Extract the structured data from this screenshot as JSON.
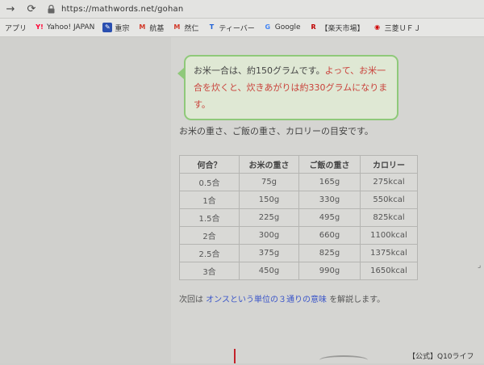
{
  "browser": {
    "url": "https://mathwords.net/gohan"
  },
  "bookmarks": [
    {
      "label": "アプリ",
      "icon": "apps-icon",
      "glyph": "",
      "color": ""
    },
    {
      "label": "Yahoo! JAPAN",
      "icon": "yahoo-icon",
      "glyph": "Y!",
      "color": "#ff0033"
    },
    {
      "label": "重宗",
      "icon": "bookmark-icon",
      "glyph": "✎",
      "color": "#2a4fb0"
    },
    {
      "label": "航基",
      "icon": "m-icon",
      "glyph": "M",
      "color": "#d23a2a"
    },
    {
      "label": "然仁",
      "icon": "m-icon",
      "glyph": "M",
      "color": "#d23a2a"
    },
    {
      "label": "ティーバー",
      "icon": "tver-icon",
      "glyph": "T",
      "color": "#1d5fd6"
    },
    {
      "label": "Google",
      "icon": "google-icon",
      "glyph": "G",
      "color": "#4285f4"
    },
    {
      "label": "【楽天市場】",
      "icon": "rakuten-icon",
      "glyph": "R",
      "color": "#bf0000"
    },
    {
      "label": "三菱ＵＦＪ",
      "icon": "mufg-icon",
      "glyph": "◉",
      "color": "#d00000"
    }
  ],
  "bubble": {
    "text1": "お米一合は、約150グラムです。",
    "text2": "よって、お米一合を炊くと、",
    "text3": "炊きあがりは約330グラムになります。"
  },
  "intro": "お米の重さ、ご飯の重さ、カロリーの目安です。",
  "table": {
    "headers": [
      "何合？",
      "お米の重さ",
      "ご飯の重さ",
      "カロリー"
    ],
    "rows": [
      [
        "0.5合",
        "75g",
        "165g",
        "275kcal"
      ],
      [
        "1合",
        "150g",
        "330g",
        "550kcal"
      ],
      [
        "1.5合",
        "225g",
        "495g",
        "825kcal"
      ],
      [
        "2合",
        "300g",
        "660g",
        "1100kcal"
      ],
      [
        "2.5合",
        "375g",
        "825g",
        "1375kcal"
      ],
      [
        "3合",
        "450g",
        "990g",
        "1650kcal"
      ]
    ]
  },
  "next": {
    "prefix": "次回は",
    "link": "オンスという単位の３通りの意味",
    "suffix": "を解説します。"
  },
  "ad": {
    "text": "【公式】Q10ライフ"
  },
  "colors": {
    "bubble_border": "#8fc97a",
    "highlight_red": "#c9413a",
    "link_blue": "#3a55c9"
  }
}
